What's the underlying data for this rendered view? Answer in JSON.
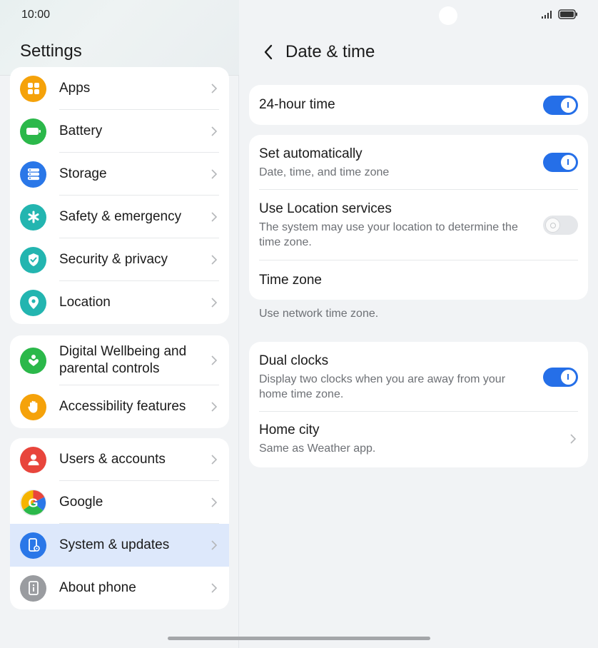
{
  "status": {
    "time": "10:00"
  },
  "left": {
    "title": "Settings",
    "groups": [
      {
        "items": [
          {
            "label": "Apps",
            "icon": "apps-icon",
            "color": "#f5a20a"
          },
          {
            "label": "Battery",
            "icon": "battery-icon",
            "color": "#2bb84a"
          },
          {
            "label": "Storage",
            "icon": "storage-icon",
            "color": "#2a77e8"
          },
          {
            "label": "Safety & emergency",
            "icon": "asterisk-icon",
            "color": "#23b5b0"
          },
          {
            "label": "Security & privacy",
            "icon": "shield-icon",
            "color": "#23b5b0"
          },
          {
            "label": "Location",
            "icon": "location-pin-icon",
            "color": "#23b5b0"
          }
        ]
      },
      {
        "items": [
          {
            "label": "Digital Wellbeing and parental controls",
            "icon": "wellbeing-icon",
            "color": "#2bb84a"
          },
          {
            "label": "Accessibility features",
            "icon": "hand-icon",
            "color": "#f5a20a"
          }
        ]
      },
      {
        "items": [
          {
            "label": "Users & accounts",
            "icon": "user-icon",
            "color": "#e8453c"
          },
          {
            "label": "Google",
            "icon": "google-icon",
            "color": "#ffffff"
          },
          {
            "label": "System & updates",
            "icon": "system-phone-icon",
            "color": "#2a77e8",
            "selected": true
          },
          {
            "label": "About phone",
            "icon": "info-phone-icon",
            "color": "#9a9ca0"
          }
        ]
      }
    ]
  },
  "right": {
    "title": "Date & time",
    "hour24": {
      "title": "24-hour time",
      "on": true
    },
    "set_auto": {
      "title": "Set automatically",
      "subtitle": "Date, time, and time zone",
      "on": true
    },
    "location_services": {
      "title": "Use Location services",
      "subtitle": "The system may use your location to determine the time zone.",
      "on": false
    },
    "time_zone": {
      "title": "Time zone"
    },
    "network_note": "Use network time zone.",
    "dual_clocks": {
      "title": "Dual clocks",
      "subtitle": "Display two clocks when you are away from your home time zone.",
      "on": true
    },
    "home_city": {
      "title": "Home city",
      "subtitle": "Same as Weather app."
    }
  },
  "colors": {
    "accent": "#256fe8",
    "selected_bg": "#dde8fb"
  }
}
